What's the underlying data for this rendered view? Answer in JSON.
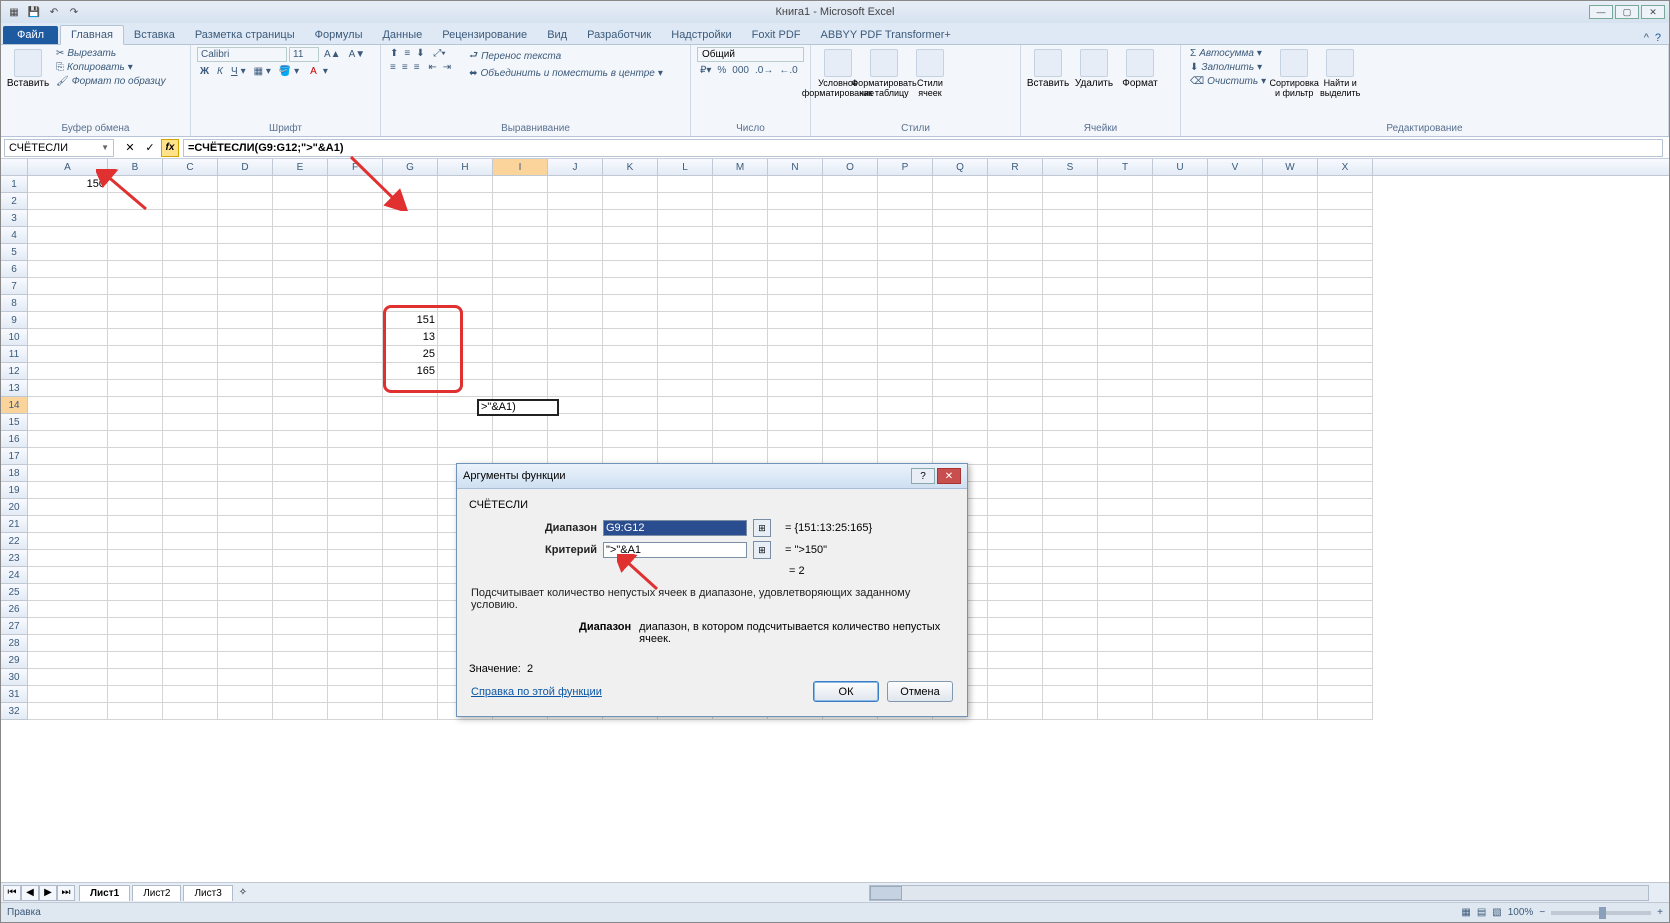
{
  "app": {
    "title": "Книга1 - Microsoft Excel"
  },
  "tabs": {
    "file": "Файл",
    "items": [
      "Главная",
      "Вставка",
      "Разметка страницы",
      "Формулы",
      "Данные",
      "Рецензирование",
      "Вид",
      "Разработчик",
      "Надстройки",
      "Foxit PDF",
      "ABBYY PDF Transformer+"
    ],
    "active": 0
  },
  "ribbon": {
    "clipboard": {
      "paste": "Вставить",
      "cut": "Вырезать",
      "copy": "Копировать",
      "fmt": "Формат по образцу",
      "label": "Буфер обмена"
    },
    "font": {
      "name": "Calibri",
      "size": "11",
      "label": "Шрифт"
    },
    "align": {
      "wrap": "Перенос текста",
      "merge": "Объединить и поместить в центре",
      "label": "Выравнивание"
    },
    "number": {
      "fmt": "Общий",
      "label": "Число"
    },
    "styles": {
      "cond": "Условное форматирование",
      "table": "Форматировать как таблицу",
      "cell": "Стили ячеек",
      "label": "Стили"
    },
    "cells": {
      "ins": "Вставить",
      "del": "Удалить",
      "fmt": "Формат",
      "label": "Ячейки"
    },
    "editing": {
      "sum": "Автосумма",
      "fill": "Заполнить",
      "clear": "Очистить",
      "sort": "Сортировка и фильтр",
      "find": "Найти и выделить",
      "label": "Редактирование"
    }
  },
  "formula": {
    "name": "СЧЁТЕСЛИ",
    "value": "=СЧЁТЕСЛИ(G9:G12;\">\"&A1)"
  },
  "cols": [
    "A",
    "B",
    "C",
    "D",
    "E",
    "F",
    "G",
    "H",
    "I",
    "J",
    "K",
    "L",
    "M",
    "N",
    "O",
    "P",
    "Q",
    "R",
    "S",
    "T",
    "U",
    "V",
    "W",
    "X"
  ],
  "cells": {
    "A1": "150",
    "G9": "151",
    "G10": "13",
    "G11": "25",
    "G12": "165",
    "I14": ">\"&A1)"
  },
  "dialog": {
    "title": "Аргументы функции",
    "fn": "СЧЁТЕСЛИ",
    "range_label": "Диапазон",
    "range_val": "G9:G12",
    "range_eval": "{151:13:25:165}",
    "crit_label": "Критерий",
    "crit_val": "\">\"&A1",
    "crit_eval": "\">150\"",
    "result_eq": "= 2",
    "desc1": "Подсчитывает количество непустых ячеек в диапазоне, удовлетворяющих заданному условию.",
    "desc2_label": "Диапазон",
    "desc2_text": "диапазон, в котором подсчитывается количество непустых ячеек.",
    "value_label": "Значение:",
    "value": "2",
    "help": "Справка по этой функции",
    "ok": "ОК",
    "cancel": "Отмена"
  },
  "sheets": {
    "items": [
      "Лист1",
      "Лист2",
      "Лист3"
    ],
    "active": 0
  },
  "status": {
    "mode": "Правка",
    "zoom": "100%"
  }
}
